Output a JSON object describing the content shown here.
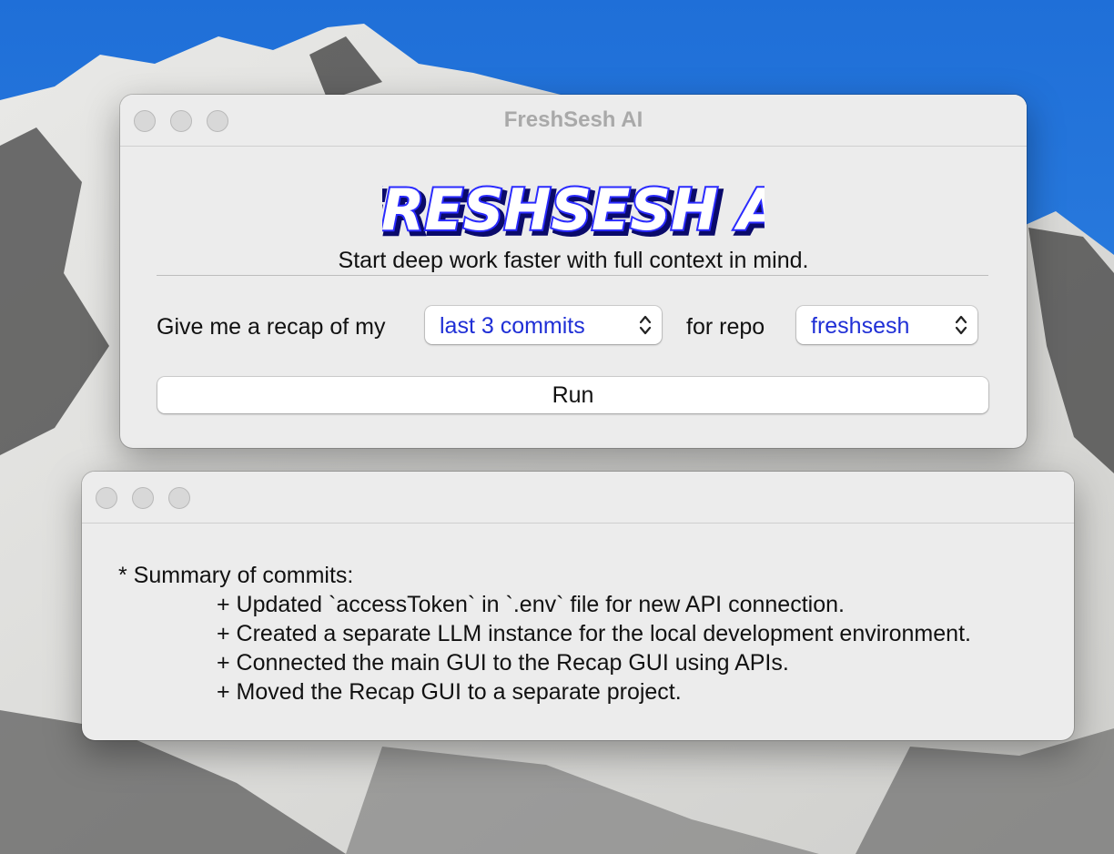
{
  "main_window": {
    "title": "FreshSesh AI",
    "logo_text": "FRESHSESH AI",
    "tagline": "Start deep work faster with full context in mind.",
    "prompt_prefix": "Give me a recap of my",
    "scope_select": {
      "value": "last 3 commits"
    },
    "prompt_middle": "for repo",
    "repo_select": {
      "value": "freshsesh"
    },
    "run_label": "Run"
  },
  "output_window": {
    "summary_heading": "* Summary of commits:",
    "items": [
      "+ Updated `accessToken` in `.env` file for new API connection.",
      "+ Created a separate LLM instance for the local development environment.",
      "+ Connected the main GUI to the Recap GUI using APIs.",
      "+ Moved the Recap GUI to a separate project."
    ]
  },
  "colors": {
    "wallpaper_sky": "#2c7fdc",
    "select_text": "#1f2fd6",
    "logo_fill": "#2a2aff"
  },
  "icons": [
    "close-button-icon",
    "minimize-button-icon",
    "zoom-button-icon",
    "select-chevron-icon"
  ]
}
